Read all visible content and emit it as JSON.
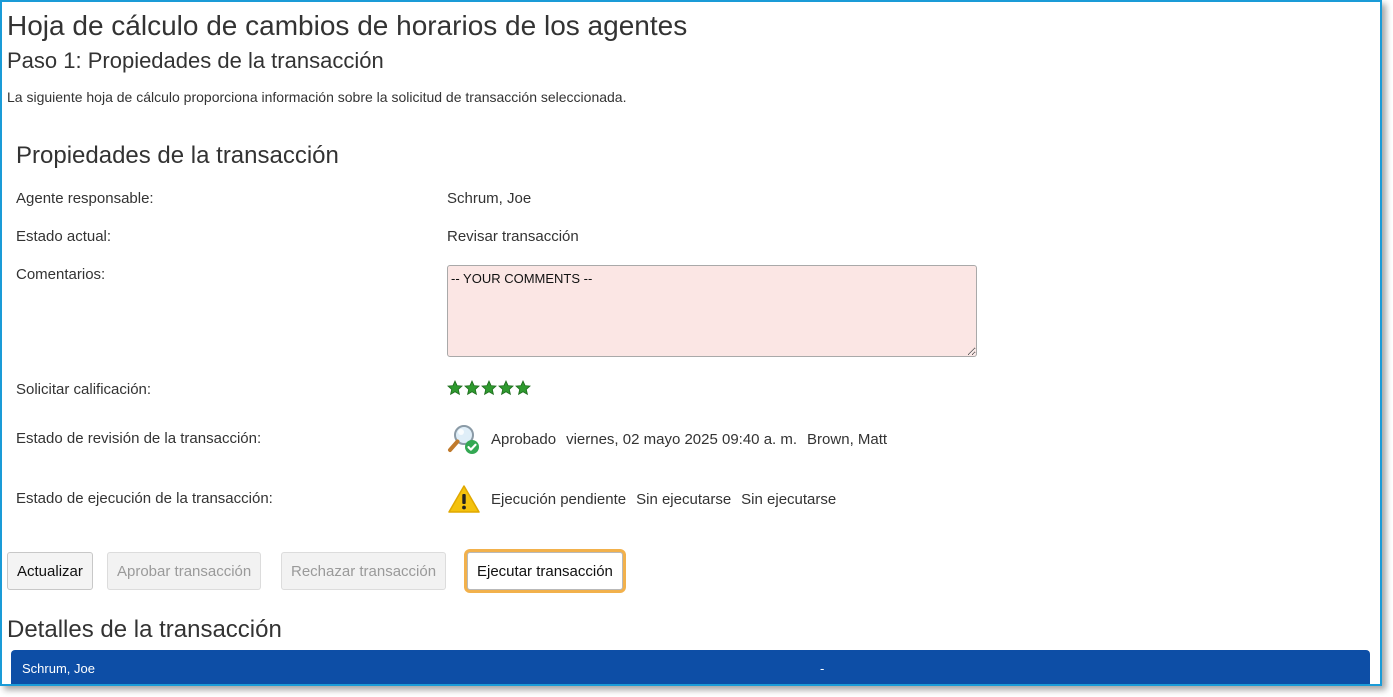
{
  "page": {
    "title": "Hoja de cálculo de cambios de horarios de los agentes",
    "subtitle": "Paso 1: Propiedades de la transacción",
    "description": "La siguiente hoja de cálculo proporciona información sobre la solicitud de transacción seleccionada."
  },
  "properties": {
    "section_title": "Propiedades de la transacción",
    "agent_label": "Agente responsable:",
    "agent_value": "Schrum, Joe",
    "state_label": "Estado actual:",
    "state_value": "Revisar transacción",
    "comments_label": "Comentarios:",
    "comments_value": "-- YOUR COMMENTS --",
    "rating_label": "Solicitar calificación:",
    "rating_value": 5,
    "rating_max": 5,
    "review_label": "Estado de revisión de la transacción:",
    "review_status": "Aprobado",
    "review_date": "viernes, 02 mayo 2025 09:40 a. m.",
    "review_by": "Brown, Matt",
    "review_icon": "magnifier-check-icon",
    "exec_label": "Estado de ejecución de la transacción:",
    "exec_status": "Ejecución pendiente",
    "exec_date": "Sin ejecutarse",
    "exec_by": "Sin ejecutarse",
    "exec_icon": "warning-icon"
  },
  "buttons": {
    "refresh": "Actualizar",
    "approve": "Aprobar transacción",
    "reject": "Rechazar transacción",
    "execute": "Ejecutar transacción"
  },
  "details": {
    "title": "Detalles de la transacción",
    "agent": "Schrum, Joe",
    "value": "-"
  },
  "colors": {
    "frame_border": "#1a9bd7",
    "comments_bg": "#fbe6e4",
    "highlight": "#f2b14c",
    "details_bar": "#0d4ea6",
    "star_green": "#2f9a2f"
  }
}
